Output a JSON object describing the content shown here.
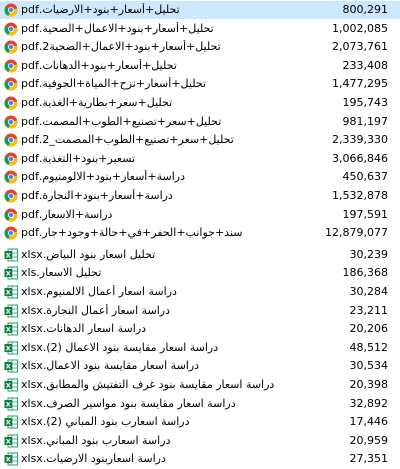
{
  "colors": {
    "selection": "#cce8ff",
    "pdf_icon": "chrome-icon",
    "excel_icon": "excel-icon"
  },
  "files": [
    {
      "name": "تحليل+أسعار+بنود+الارضيات.pdf",
      "size": "800,291",
      "type": "pdf",
      "selected": true
    },
    {
      "name": "تحليل+أسعار+بنود+الاعمال+الصحية.pdf",
      "size": "1,002,085",
      "type": "pdf"
    },
    {
      "name": "تحليل+أسعار+بنود+الاعمال+الصحية2.pdf",
      "size": "2,073,761",
      "type": "pdf"
    },
    {
      "name": "تحليل+أسعار+بنود+الدهانات.pdf",
      "size": "233,408",
      "type": "pdf"
    },
    {
      "name": "تحليل+أسعار+نزح+المياة+الجوفية.pdf",
      "size": "1,477,295",
      "type": "pdf"
    },
    {
      "name": "تحليل+سعر+بطارية+الغذية.pdf",
      "size": "195,743",
      "type": "pdf"
    },
    {
      "name": "تحليل+سعر+تصنيع+الطوب+المصمت.pdf",
      "size": "981,197",
      "type": "pdf"
    },
    {
      "name": "تحليل+سعر+تصنيع+الطوب+المصمت_2.pdf",
      "size": "2,339,330",
      "type": "pdf"
    },
    {
      "name": "تسعير+بنود+التغذية.pdf",
      "size": "3,066,846",
      "type": "pdf"
    },
    {
      "name": "دراسة+أسعار+بنود+الالومنيوم.pdf",
      "size": "450,637",
      "type": "pdf"
    },
    {
      "name": "دراسة+أسعار+بنود+النجارة.pdf",
      "size": "1,532,878",
      "type": "pdf"
    },
    {
      "name": "دراسة+الاسعار.pdf",
      "size": "197,591",
      "type": "pdf"
    },
    {
      "name": "سند+جوانب+الحفر+في+حالة+وجود+جار.pdf",
      "size": "12,879,077",
      "type": "pdf"
    },
    {
      "name": "تحليل اسعار بنود البياض.xlsx",
      "size": "30,239",
      "type": "xlsx"
    },
    {
      "name": "تحليل الاسعار.xls",
      "size": "186,368",
      "type": "xls"
    },
    {
      "name": "دراسة اسعار أعمال الالمنيوم.xlsx",
      "size": "30,284",
      "type": "xlsx"
    },
    {
      "name": "دراسة اسعار أعمال النجارة.xlsx",
      "size": "23,211",
      "type": "xlsx"
    },
    {
      "name": "دراسة اسعار الدهانات.xlsx",
      "size": "20,206",
      "type": "xlsx"
    },
    {
      "name": "دراسة اسعار مقايسة بنود الاعمال (2).xlsx",
      "size": "48,512",
      "type": "xlsx"
    },
    {
      "name": "دراسة اسعار مقايسة بنود الاعمال.xlsx",
      "size": "30,534",
      "type": "xlsx"
    },
    {
      "name": "دراسة اسعار مقايسة بنود غرف التفتيش والمطابق.xlsx",
      "size": "20,398",
      "type": "xlsx"
    },
    {
      "name": "دراسة اسعار مقايسة بنود مواسير الصرف.xlsx",
      "size": "32,892",
      "type": "xlsx"
    },
    {
      "name": "دراسة اسعارب بنود المباني (2).xlsx",
      "size": "17,446",
      "type": "xlsx"
    },
    {
      "name": "دراسة اسعارب بنود المباني.xlsx",
      "size": "20,959",
      "type": "xlsx"
    },
    {
      "name": "دراسة اسعاربنود الارضيات.xlsx",
      "size": "27,351",
      "type": "xlsx"
    }
  ]
}
